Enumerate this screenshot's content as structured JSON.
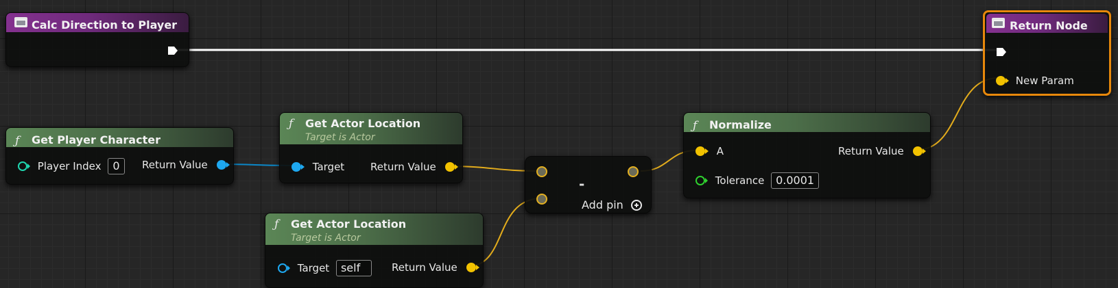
{
  "graph": {
    "entry_node": {
      "title": "Calc Direction to Player",
      "icon": "function-entry-icon"
    },
    "return_node": {
      "title": "Return Node",
      "icon": "function-return-icon",
      "input_label": "New Param",
      "selected": true
    },
    "get_player_character": {
      "title": "Get Player Character",
      "icon": "fx-icon",
      "player_index_label": "Player Index",
      "player_index_value": "0",
      "return_label": "Return Value"
    },
    "get_actor_location_1": {
      "title": "Get Actor Location",
      "subtitle": "Target is Actor",
      "target_label": "Target",
      "return_label": "Return Value"
    },
    "get_actor_location_2": {
      "title": "Get Actor Location",
      "subtitle": "Target is Actor",
      "target_label": "Target",
      "target_value": "self",
      "return_label": "Return Value"
    },
    "subtract_node": {
      "operator": "-",
      "add_pin_label": "Add pin"
    },
    "normalize": {
      "title": "Normalize",
      "a_label": "A",
      "tolerance_label": "Tolerance",
      "tolerance_value": "0.0001",
      "return_label": "Return Value"
    }
  },
  "colors": {
    "exec_wire": "#ffffff",
    "vector_wire": "#e3ac1c",
    "object_wire": "#0b88c9",
    "selection": "#e8880b",
    "function_header": "#84318f",
    "pure_function_header": "#5b8656"
  }
}
